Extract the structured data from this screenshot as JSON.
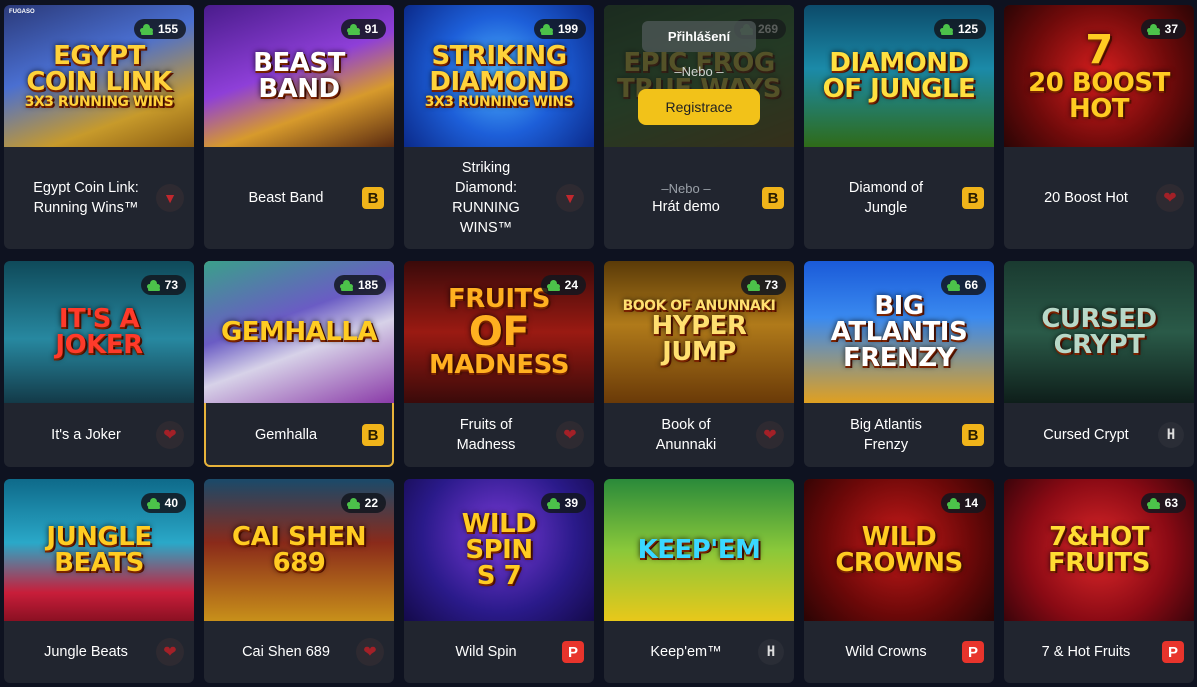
{
  "games": [
    {
      "name_lines": [
        "Egypt Coin Link:",
        "Running Wins™"
      ],
      "art": [
        "EGYPT",
        "COIN LINK",
        "3X3 RUNNING WINS"
      ],
      "players": "155",
      "badge": "tri",
      "badge_text": "▼",
      "provider": "FUGASO",
      "bg": "linear-gradient(160deg,#2b3a7a 0%,#4a6fd1 40%,#c79a2b 75%,#8a5c12 100%)",
      "art_color": "#ffd23a"
    },
    {
      "name_lines": [
        "Beast Band"
      ],
      "art": [
        "BEAST",
        "BAND"
      ],
      "players": "91",
      "badge": "b",
      "badge_text": "B",
      "bg": "linear-gradient(160deg,#4a1c8c 0%,#8e3fd8 45%,#d79a2c 70%,#5a2a10 100%)",
      "art_color": "#ffffff"
    },
    {
      "name_lines": [
        "Striking",
        "Diamond:",
        "RUNNING",
        "WINS™"
      ],
      "art": [
        "STRIKING",
        "DIAMOND",
        "3X3 RUNNING WINS"
      ],
      "players": "199",
      "badge": "tri",
      "badge_text": "▼",
      "bg": "radial-gradient(circle at 50% 50%,#4fb6ff 0%,#1d5fd9 50%,#0b2a8a 100%)",
      "art_color": "#ffd23a"
    },
    {
      "name_lines": [],
      "art": [
        "EPIC FROG",
        "TRUE WAYS"
      ],
      "players": "269",
      "badge": "b",
      "badge_text": "B",
      "overlay": true,
      "login_label": "Přihlášení",
      "or_label": "–Nebo –",
      "register_label": "Registrace",
      "demo_or": "–Nebo –",
      "demo_label": "Hrát demo",
      "bg": "linear-gradient(160deg,#1f4a2a 0%,#3e7d3c 50%,#7a5a1a 100%)",
      "art_color": "#e8d24a"
    },
    {
      "name_lines": [
        "Diamond of",
        "Jungle"
      ],
      "art": [
        "DIAMOND",
        "OF JUNGLE"
      ],
      "players": "125",
      "badge": "b",
      "badge_text": "B",
      "bg": "linear-gradient(180deg,#0c4a6a 0%,#1b8aa8 45%,#2f6b18 100%)",
      "art_color": "#ffe040"
    },
    {
      "name_lines": [
        "20 Boost Hot"
      ],
      "art": [
        "7",
        "20 BOOST",
        "HOT"
      ],
      "players": "37",
      "badge": "heart",
      "badge_text": "❤",
      "bg": "radial-gradient(circle at 50% 50%,#d81e1e 0%,#6e0a0a 60%,#2a0505 100%)",
      "art_color": "#ffcc22"
    },
    {
      "name_lines": [
        "It's a Joker"
      ],
      "art": [
        "IT'S A",
        "JOKER"
      ],
      "players": "73",
      "badge": "heart",
      "badge_text": "❤",
      "bg": "linear-gradient(180deg,#0f4a5a 0%,#2788a0 55%,#133a48 100%)",
      "art_color": "#ff3a2a"
    },
    {
      "name_lines": [
        "Gemhalla"
      ],
      "art": [
        "GEMHALLA"
      ],
      "players": "185",
      "badge": "b",
      "badge_text": "B",
      "highlight": true,
      "bg": "linear-gradient(160deg,#3aa08a 0%,#6a5cc4 40%,#d7d2e8 60%,#8a3aa8 100%)",
      "art_color": "#ffcc22"
    },
    {
      "name_lines": [
        "Fruits of",
        "Madness"
      ],
      "art": [
        "FRUITS",
        "OF",
        "MADNESS"
      ],
      "players": "24",
      "badge": "heart",
      "badge_text": "❤",
      "bg": "linear-gradient(180deg,#3a0a0a 0%,#9a1a12 50%,#3a0a0a 100%)",
      "art_color": "#ffb020"
    },
    {
      "name_lines": [
        "Book of",
        "Anunnaki"
      ],
      "art": [
        "BOOK OF ANUNNAKI",
        "HYPER JUMP"
      ],
      "players": "73",
      "badge": "heart",
      "badge_text": "❤",
      "bg": "linear-gradient(180deg,#5a3a08 0%,#b07a1a 45%,#6a3a08 100%)",
      "art_color": "#ffe070"
    },
    {
      "name_lines": [
        "Big Atlantis",
        "Frenzy"
      ],
      "art": [
        "BIG ATLANTIS",
        "FRENZY"
      ],
      "players": "66",
      "badge": "b",
      "badge_text": "B",
      "bg": "linear-gradient(180deg,#1a5ad8 0%,#3a8af0 40%,#e0a020 100%)",
      "art_color": "#ffffff"
    },
    {
      "name_lines": [
        "Cursed Crypt"
      ],
      "art": [
        "CURSED",
        "CRYPT"
      ],
      "players": "",
      "badge": "h",
      "badge_text": "H",
      "bg": "linear-gradient(180deg,#1a3a30 0%,#2a5a48 50%,#0e1e1a 100%)",
      "art_color": "#b8d8c8"
    },
    {
      "name_lines": [
        "Jungle Beats"
      ],
      "art": [
        "JUNGLE BEATS"
      ],
      "players": "40",
      "badge": "heart",
      "badge_text": "❤",
      "bg": "linear-gradient(180deg,#0e6a8a 0%,#2aa8c8 45%,#c81e3a 80%,#8a1022 100%)",
      "art_color": "#ffcc22"
    },
    {
      "name_lines": [
        "Cai Shen 689"
      ],
      "art": [
        "CAI SHEN 689"
      ],
      "players": "22",
      "badge": "heart",
      "badge_text": "❤",
      "bg": "linear-gradient(180deg,#1a4a6a 0%,#8a2a1a 45%,#c8901a 100%)",
      "art_color": "#ffcc22"
    },
    {
      "name_lines": [
        "Wild Spin"
      ],
      "art": [
        "WILD",
        "SPIN",
        "S  7"
      ],
      "players": "39",
      "badge": "p",
      "badge_text": "P",
      "bg": "radial-gradient(circle at 50% 40%,#7a3ad8 0%,#2a1a8a 60%,#140a4a 100%)",
      "art_color": "#ffcc22"
    },
    {
      "name_lines": [
        "Keep'em™"
      ],
      "art": [
        "KEEP'EM"
      ],
      "players": "",
      "badge": "h",
      "badge_text": "H",
      "bg": "linear-gradient(180deg,#2a8a3a 0%,#8ac83a 50%,#e8c81a 100%)",
      "art_color": "#3ad8ff"
    },
    {
      "name_lines": [
        "Wild Crowns"
      ],
      "art": [
        "WILD",
        "CROWNS"
      ],
      "players": "14",
      "badge": "p",
      "badge_text": "P",
      "bg": "radial-gradient(circle at 50% 45%,#c81a1a 0%,#6a0808 60%,#2a0404 100%)",
      "art_color": "#ffcc22"
    },
    {
      "name_lines": [
        "7 & Hot Fruits"
      ],
      "art": [
        "7&HOT",
        "FRUITS"
      ],
      "players": "63",
      "badge": "p",
      "badge_text": "P",
      "bg": "radial-gradient(circle at 50% 50%,#e0282a 0%,#8a0a14 60%,#3a040a 100%)",
      "art_color": "#ffdd33"
    }
  ]
}
